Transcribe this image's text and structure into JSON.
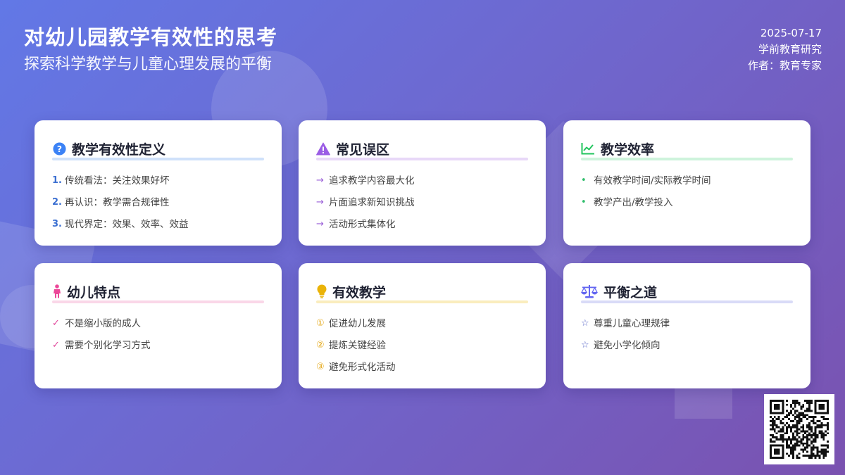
{
  "header": {
    "title": "对幼儿园教学有效性的思考",
    "subtitle": "探索科学教学与儿童心理发展的平衡",
    "date": "2025-07-17",
    "category": "学前教育研究",
    "author": "作者：教育专家"
  },
  "cards": [
    {
      "title": "教学有效性定义",
      "icon": "question-circle-icon",
      "color": "#3b82f6",
      "marker": "num",
      "items": [
        {
          "marker": "1.",
          "text": "传统看法：关注效果好坏"
        },
        {
          "marker": "2.",
          "text": "再认识：教学需合规律性"
        },
        {
          "marker": "3.",
          "text": "现代界定：效果、效率、效益"
        }
      ]
    },
    {
      "title": "常见误区",
      "icon": "warning-triangle-icon",
      "color": "#9b5de5",
      "marker": "arrow",
      "items": [
        {
          "marker": "→",
          "text": "追求教学内容最大化"
        },
        {
          "marker": "→",
          "text": "片面追求新知识挑战"
        },
        {
          "marker": "→",
          "text": "活动形式集体化"
        }
      ]
    },
    {
      "title": "教学效率",
      "icon": "line-chart-icon",
      "color": "#22c55e",
      "marker": "dot",
      "items": [
        {
          "marker": "•",
          "text": "有效教学时间/实际教学时间"
        },
        {
          "marker": "•",
          "text": "教学产出/教学投入"
        }
      ]
    },
    {
      "title": "幼儿特点",
      "icon": "child-icon",
      "color": "#ec4899",
      "marker": "check",
      "items": [
        {
          "marker": "✓",
          "text": "不是缩小版的成人"
        },
        {
          "marker": "✓",
          "text": "需要个别化学习方式"
        }
      ]
    },
    {
      "title": "有效教学",
      "icon": "lightbulb-icon",
      "color": "#eab308",
      "marker": "circ",
      "items": [
        {
          "marker": "①",
          "text": "促进幼儿发展"
        },
        {
          "marker": "②",
          "text": "提炼关键经验"
        },
        {
          "marker": "③",
          "text": "避免形式化活动"
        }
      ]
    },
    {
      "title": "平衡之道",
      "icon": "balance-scale-icon",
      "color": "#6366f1",
      "marker": "star",
      "items": [
        {
          "marker": "☆",
          "text": "尊重儿童心理规律"
        },
        {
          "marker": "☆",
          "text": "避免小学化倾向"
        }
      ]
    }
  ]
}
